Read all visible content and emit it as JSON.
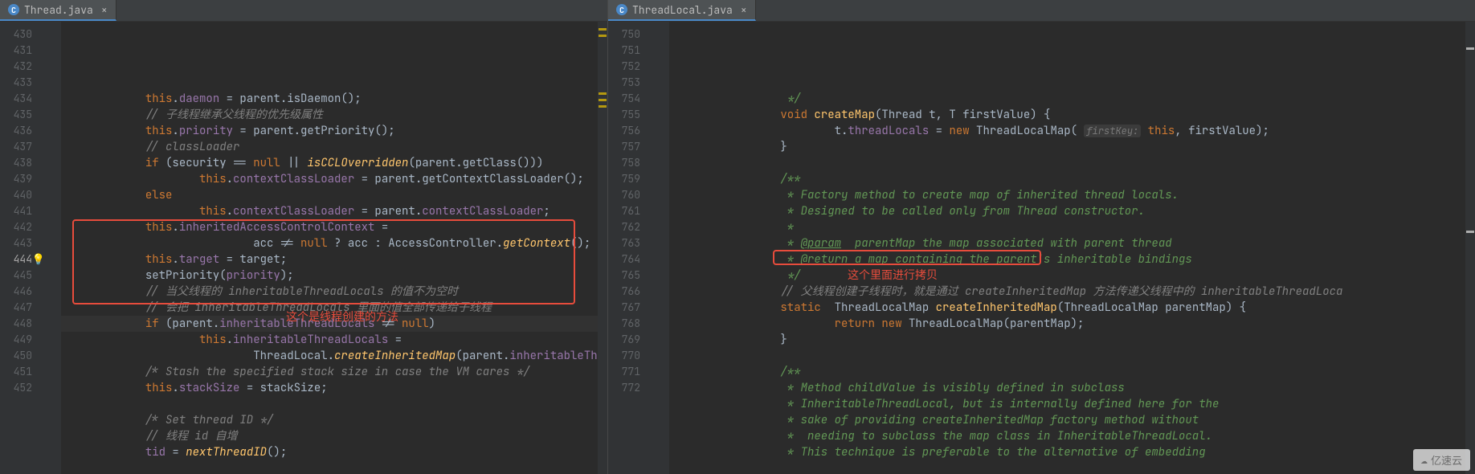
{
  "left": {
    "tab": {
      "icon": "C",
      "name": "Thread.java",
      "close": "×"
    },
    "lineStart": 430,
    "lineEnd": 452,
    "currentLine": 444,
    "code": [
      [
        [
          "pl",
          24
        ],
        [
          "kw",
          "this"
        ],
        [
          "p",
          "."
        ],
        [
          "fld",
          "daemon"
        ],
        [
          "p",
          " = parent.isDaemon();"
        ]
      ],
      [
        [
          "pl",
          24
        ],
        [
          "cmt",
          "// 子线程继承父线程的优先级属性"
        ]
      ],
      [
        [
          "pl",
          24
        ],
        [
          "kw",
          "this"
        ],
        [
          "p",
          "."
        ],
        [
          "fld",
          "priority"
        ],
        [
          "p",
          " = parent.getPriority();"
        ]
      ],
      [
        [
          "pl",
          24
        ],
        [
          "cmt",
          "// classLoader"
        ]
      ],
      [
        [
          "pl",
          24
        ],
        [
          "kw",
          "if "
        ],
        [
          "p",
          "(security == "
        ],
        [
          "kw",
          "null"
        ],
        [
          "p",
          " || "
        ],
        [
          "fnit",
          "isCCLOverridden"
        ],
        [
          "p",
          "(parent.getClass()))"
        ]
      ],
      [
        [
          "pl",
          40
        ],
        [
          "kw",
          "this"
        ],
        [
          "p",
          "."
        ],
        [
          "fld",
          "contextClassLoader"
        ],
        [
          "p",
          " = parent.getContextClassLoader();"
        ]
      ],
      [
        [
          "pl",
          24
        ],
        [
          "kw",
          "else"
        ]
      ],
      [
        [
          "pl",
          40
        ],
        [
          "kw",
          "this"
        ],
        [
          "p",
          "."
        ],
        [
          "fld",
          "contextClassLoader"
        ],
        [
          "p",
          " = parent."
        ],
        [
          "fld",
          "contextClassLoader"
        ],
        [
          "p",
          ";"
        ]
      ],
      [
        [
          "pl",
          24
        ],
        [
          "kw",
          "this"
        ],
        [
          "p",
          "."
        ],
        [
          "fld",
          "inheritedAccessControlContext"
        ],
        [
          "p",
          " ="
        ]
      ],
      [
        [
          "pl",
          56
        ],
        [
          "p",
          "acc != "
        ],
        [
          "kw",
          "null"
        ],
        [
          "p",
          " ? acc : AccessController."
        ],
        [
          "fnit",
          "getContext"
        ],
        [
          "p",
          "();"
        ]
      ],
      [
        [
          "pl",
          24
        ],
        [
          "kw",
          "this"
        ],
        [
          "p",
          "."
        ],
        [
          "fld",
          "target"
        ],
        [
          "p",
          " = target;"
        ]
      ],
      [
        [
          "pl",
          24
        ],
        [
          "p",
          "setPriority("
        ],
        [
          "fld",
          "priority"
        ],
        [
          "p",
          ");"
        ]
      ],
      [
        [
          "pl",
          24
        ],
        [
          "cmt",
          "// 当父线程的 inheritableThreadLocals 的值不为空时"
        ]
      ],
      [
        [
          "pl",
          24
        ],
        [
          "cmt",
          "// 会把 inheritableThreadLocals 里面的值全部传递给子线程"
        ]
      ],
      [
        [
          "pl",
          24
        ],
        [
          "kw",
          "if "
        ],
        [
          "p",
          "(parent."
        ],
        [
          "fld",
          "inheritableThreadLocals"
        ],
        [
          "p",
          " != "
        ],
        [
          "kw",
          "null"
        ],
        [
          "p",
          ")"
        ]
      ],
      [
        [
          "pl",
          40
        ],
        [
          "kw",
          "this"
        ],
        [
          "p",
          "."
        ],
        [
          "fld",
          "inheritableThreadLocals"
        ],
        [
          "p",
          " ="
        ]
      ],
      [
        [
          "pl",
          56
        ],
        [
          "p",
          "ThreadLocal."
        ],
        [
          "fnit",
          "createInheritedMap"
        ],
        [
          "p",
          "(parent."
        ],
        [
          "fld",
          "inheritableThreadLocals"
        ],
        [
          "p",
          ");"
        ]
      ],
      [
        [
          "pl",
          24
        ],
        [
          "cmt",
          "/* Stash the specified stack size in case the VM cares */"
        ]
      ],
      [
        [
          "pl",
          24
        ],
        [
          "kw",
          "this"
        ],
        [
          "p",
          "."
        ],
        [
          "fld",
          "stackSize"
        ],
        [
          "p",
          " = stackSize;"
        ]
      ],
      [
        [
          "pl",
          0
        ]
      ],
      [
        [
          "pl",
          24
        ],
        [
          "cmt",
          "/* Set thread ID */"
        ]
      ],
      [
        [
          "pl",
          24
        ],
        [
          "cmt",
          "// 线程 id 自增"
        ]
      ],
      [
        [
          "pl",
          24
        ],
        [
          "fld",
          "tid"
        ],
        [
          "p",
          " = "
        ],
        [
          "fnit",
          "nextThreadID"
        ],
        [
          "p",
          "();"
        ]
      ]
    ],
    "redLabel": "这个是线程创建的方法"
  },
  "right": {
    "tab": {
      "icon": "C",
      "name": "ThreadLocal.java",
      "close": "×"
    },
    "lineStart": 750,
    "lineEnd": 772,
    "code": [
      [
        [
          "pl",
          32
        ],
        [
          "doc",
          " */"
        ]
      ],
      [
        [
          "pl",
          32
        ],
        [
          "kw",
          "void "
        ],
        [
          "fn",
          "createMap"
        ],
        [
          "p",
          "(Thread t, "
        ],
        [
          "ty",
          "T"
        ],
        [
          "p",
          " firstValue) {"
        ]
      ],
      [
        [
          "pl",
          48
        ],
        [
          "p",
          "t."
        ],
        [
          "fld",
          "threadLocals"
        ],
        [
          "p",
          " = "
        ],
        [
          "kw",
          "new "
        ],
        [
          "p",
          "ThreadLocalMap( "
        ],
        [
          "hint",
          "firstKey:"
        ],
        [
          "p",
          " "
        ],
        [
          "kw",
          "this"
        ],
        [
          "p",
          ", firstValue);"
        ]
      ],
      [
        [
          "pl",
          32
        ],
        [
          "p",
          "}"
        ]
      ],
      [
        [
          "pl",
          0
        ]
      ],
      [
        [
          "pl",
          32
        ],
        [
          "doc",
          "/**"
        ]
      ],
      [
        [
          "pl",
          32
        ],
        [
          "doc",
          " * Factory method to create map of inherited thread locals."
        ]
      ],
      [
        [
          "pl",
          32
        ],
        [
          "doc",
          " * Designed to be called only from Thread constructor."
        ]
      ],
      [
        [
          "pl",
          32
        ],
        [
          "doc",
          " *"
        ]
      ],
      [
        [
          "pl",
          32
        ],
        [
          "doc",
          " * "
        ],
        [
          "doctag",
          "@param"
        ],
        [
          "doc",
          "  parentMap the map associated with parent thread"
        ]
      ],
      [
        [
          "pl",
          32
        ],
        [
          "doc",
          " * "
        ],
        [
          "doctag",
          "@return"
        ],
        [
          "doc",
          " a map containing the parent's inheritable bindings"
        ]
      ],
      [
        [
          "pl",
          32
        ],
        [
          "doc",
          " */"
        ]
      ],
      [
        [
          "pl",
          32
        ],
        [
          "cmt",
          "// 父线程创建子线程时，就是通过 createInheritedMap 方法传递父线程中的 inheritableThreadLoca"
        ]
      ],
      [
        [
          "pl",
          32
        ],
        [
          "kw",
          "static "
        ],
        [
          "p",
          " ThreadLocalMap "
        ],
        [
          "fn",
          "createInheritedMap"
        ],
        [
          "p",
          "(ThreadLocalMap parentMap) {"
        ]
      ],
      [
        [
          "pl",
          48
        ],
        [
          "kw",
          "return new "
        ],
        [
          "p",
          "ThreadLocalMap(parentMap);"
        ]
      ],
      [
        [
          "pl",
          32
        ],
        [
          "p",
          "}"
        ]
      ],
      [
        [
          "pl",
          0
        ]
      ],
      [
        [
          "pl",
          32
        ],
        [
          "doc",
          "/**"
        ]
      ],
      [
        [
          "pl",
          32
        ],
        [
          "doc",
          " * Method childValue is visibly defined in subclass"
        ]
      ],
      [
        [
          "pl",
          32
        ],
        [
          "doc",
          " * InheritableThreadLocal, but is internally defined here for the"
        ]
      ],
      [
        [
          "pl",
          32
        ],
        [
          "doc",
          " * sake of providing createInheritedMap factory method without"
        ]
      ],
      [
        [
          "pl",
          32
        ],
        [
          "doc",
          " *  needing to subclass the map class in InheritableThreadLocal."
        ]
      ],
      [
        [
          "pl",
          32
        ],
        [
          "doc",
          " * This technique is preferable to the alternative of embedding"
        ]
      ]
    ],
    "redLabel": "这个里面进行拷贝"
  },
  "watermark": "亿速云"
}
